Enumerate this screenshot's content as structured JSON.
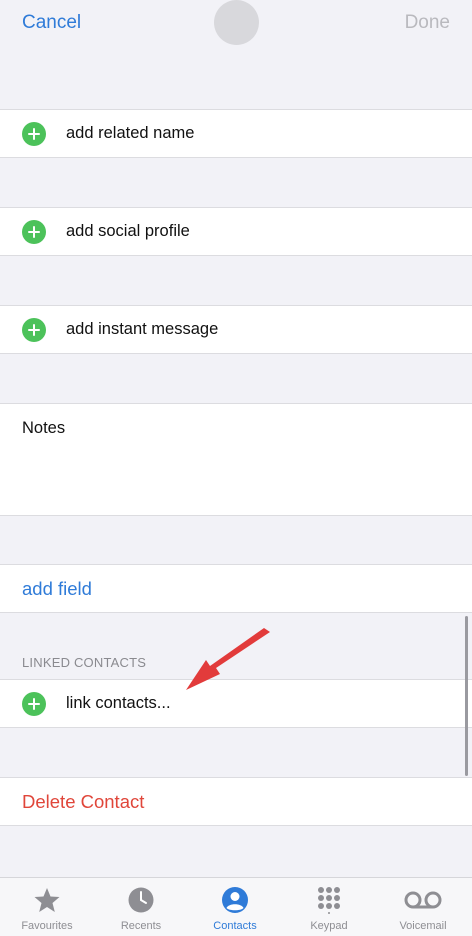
{
  "nav": {
    "cancel_label": "Cancel",
    "done_label": "Done"
  },
  "fields": {
    "related_name": "add related name",
    "social_profile": "add social profile",
    "instant_message": "add instant message",
    "notes_label": "Notes",
    "add_field": "add field"
  },
  "linked_contacts": {
    "header": "LINKED CONTACTS",
    "link_label": "link contacts..."
  },
  "delete_label": "Delete Contact",
  "colors": {
    "accent": "#2f7bd8",
    "add": "#4cc25a",
    "destructive": "#e0463a",
    "annotation_arrow": "#e23b3b"
  },
  "tabs": [
    {
      "label": "Favourites",
      "icon": "star-icon",
      "active": false
    },
    {
      "label": "Recents",
      "icon": "clock-icon",
      "active": false
    },
    {
      "label": "Contacts",
      "icon": "person-circle-icon",
      "active": true
    },
    {
      "label": "Keypad",
      "icon": "keypad-icon",
      "active": false
    },
    {
      "label": "Voicemail",
      "icon": "voicemail-icon",
      "active": false
    }
  ]
}
